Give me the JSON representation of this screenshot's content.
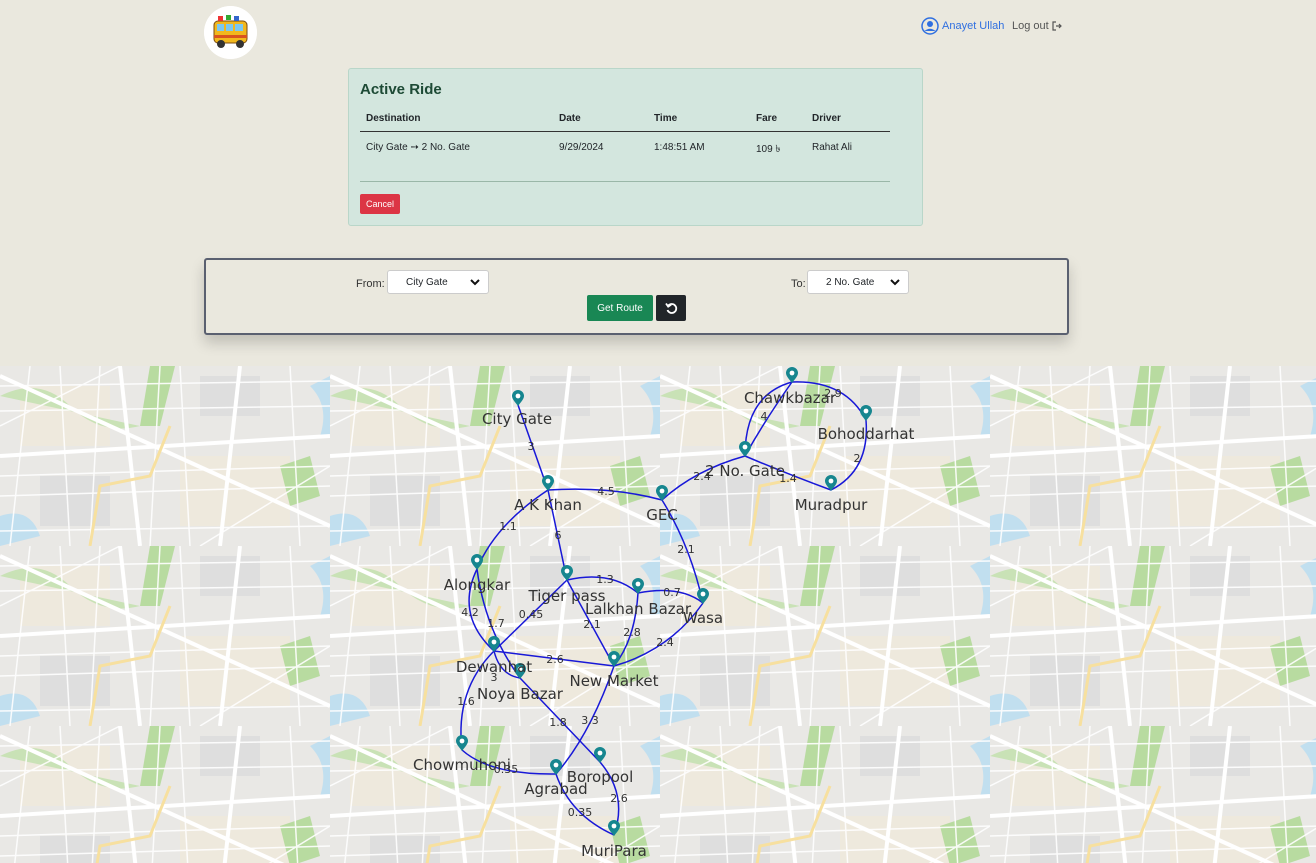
{
  "header": {
    "user_name": "Anayet Ullah",
    "logout_label": "Log out"
  },
  "active_ride": {
    "title": "Active Ride",
    "columns": [
      "Destination",
      "Date",
      "Time",
      "Fare",
      "Driver"
    ],
    "row": {
      "destination": "City Gate ➙ 2 No. Gate",
      "date": "9/29/2024",
      "time": "1:48:51 AM",
      "fare": "109 ৳",
      "driver": "Rahat Ali"
    },
    "cancel_label": "Cancel"
  },
  "route_form": {
    "from_label": "From:",
    "from_value": "City Gate",
    "to_label": "To:",
    "to_value": "2 No. Gate",
    "get_route_label": "Get Route"
  },
  "map": {
    "node_color": "#16868f",
    "edge_color": "#1818d8",
    "nodes": {
      "city_gate": "City Gate",
      "chawkbazar": "Chawkbazar",
      "bohoddarhat": "Bohoddarhat",
      "two_no_gate": "2 No. Gate",
      "ak_khan": "A K Khan",
      "gec": "GEC",
      "muradpur": "Muradpur",
      "alongkar": "Alongkar",
      "tiger_pass": "Tiger pass",
      "lalkhan_bazar": "Lalkhan Bazar",
      "wasa": "Wasa",
      "dewanhat": "Dewanhat",
      "new_market": "New Market",
      "noya_bazar": "Noya Bazar",
      "chowmuhoni": "Chowmuhoni",
      "boropool": "Boropool",
      "agrabad": "Agrabad",
      "muripara": "MuriPara"
    },
    "edges": {
      "citygate_akkhan": "3",
      "chawk_bohod": "2.9",
      "chawk_2no": "4",
      "bohod_murad": "2",
      "twono_murad": "1.4",
      "twono_gec": "2.4",
      "akkhan_gec": "4.5",
      "akkhan_alongkar": "1.1",
      "akkhan_tiger": "6",
      "gec_wasa": "2.1",
      "tiger_lalkhan": "1.3",
      "lalkhan_wasa": "0.7",
      "alongkar_dewanhat": "4.2",
      "alongkar_noya": "1.7",
      "tiger_dewanhat": "0.45",
      "tiger_newmarket": "2.1",
      "lalkhan_newmarket": "2.8",
      "wasa_newmarket": "2.4",
      "dewanhat_newmarket": "2.6",
      "dewanhat_noya": "3",
      "dewanhat_chowmuhoni": "1.6",
      "noya_boropool": "1.8",
      "newmarket_agrabad": "3.3",
      "chowmuhoni_agrabad": "0.35",
      "boropool_muripara": "2.6",
      "agrabad_muripara": "0.35"
    }
  }
}
